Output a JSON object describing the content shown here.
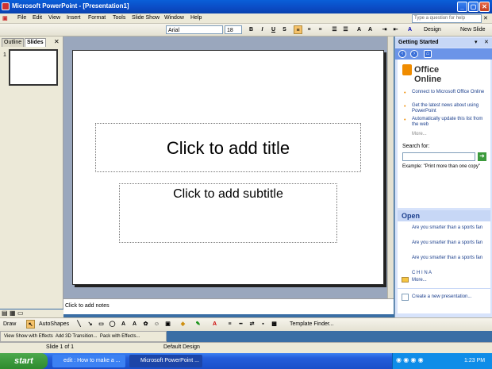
{
  "window": {
    "title": "Microsoft PowerPoint - [Presentation1]"
  },
  "menu": {
    "items": [
      "File",
      "Edit",
      "View",
      "Insert",
      "Format",
      "Tools",
      "Slide Show",
      "Window",
      "Help"
    ],
    "help_placeholder": "Type a question for help"
  },
  "format_toolbar": {
    "font": "Arial",
    "size": "18",
    "bold": "B",
    "italic": "I",
    "underline": "U",
    "shadow": "S",
    "design_label": "Design",
    "new_slide_label": "New Slide"
  },
  "left_pane": {
    "tabs": [
      "Outline",
      "Slides"
    ],
    "active_tab": "Slides",
    "slide_number": "1"
  },
  "slide": {
    "title_placeholder": "Click to add title",
    "subtitle_placeholder": "Click to add subtitle"
  },
  "notes": {
    "placeholder": "Click to add notes"
  },
  "task_pane": {
    "title": "Getting Started",
    "office_online": "Office Online",
    "links": [
      "Connect to Microsoft Office Online",
      "Get the latest news about using PowerPoint",
      "Automatically update this list from the web"
    ],
    "more": "More...",
    "search_label": "Search for:",
    "example": "Example: \"Print more than one copy\"",
    "open_title": "Open",
    "open_files": [
      "Are you smarter than a sports fan",
      "Are you smarter than a sports fan",
      "Are you smarter than a sports fan",
      "C H I N A"
    ],
    "open_more": "More...",
    "create_new": "Create a new presentation..."
  },
  "drawing_toolbar": {
    "draw": "Draw",
    "autoshapes": "AutoShapes",
    "template_finder": "Template Finder..."
  },
  "effects_toolbar": {
    "items": [
      "View Show with Effects",
      "Add 3D Transition...",
      "Pack with Effects..."
    ]
  },
  "status_bar": {
    "slide": "Slide 1 of 1",
    "design": "Default Design"
  },
  "taskbar": {
    "start": "start",
    "tasks": [
      "edit : How to make a ...",
      "Microsoft PowerPoint ..."
    ],
    "time": "1:23 PM"
  },
  "colors": {
    "title_bar": "#0b4bc4",
    "taskbar": "#245edb",
    "start_button": "#2e8b2e",
    "slide_background": "#9aa7bd",
    "task_pane": "#d7e3fb",
    "link": "#1a3e8c"
  }
}
